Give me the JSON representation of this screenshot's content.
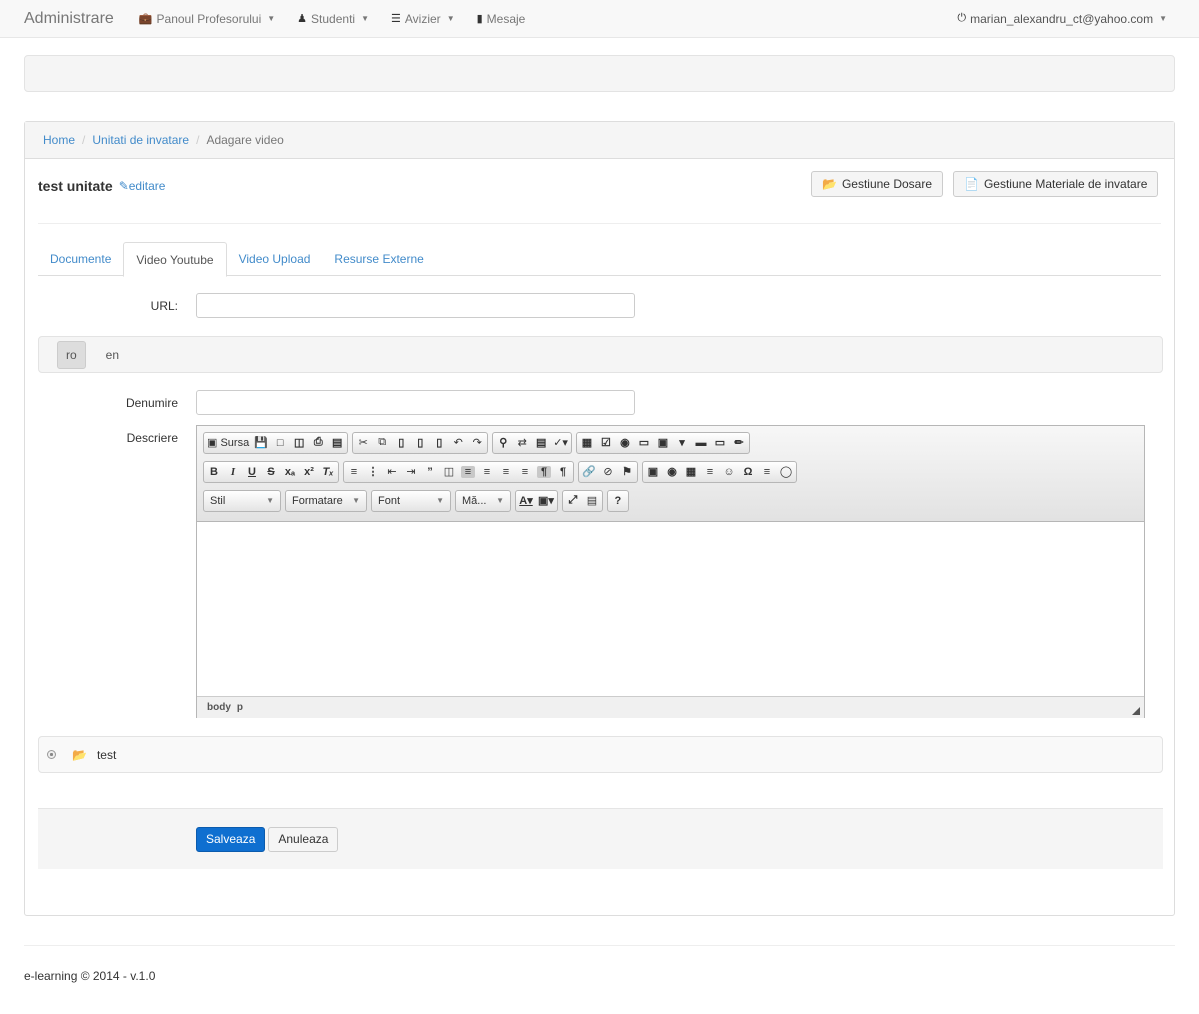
{
  "navbar": {
    "brand": "Administrare",
    "items": [
      {
        "icon": "briefcase-icon",
        "label": "Panoul Profesorului"
      },
      {
        "icon": "user-icon",
        "label": "Studenti"
      },
      {
        "icon": "list-icon",
        "label": "Avizier"
      },
      {
        "icon": "comment-icon",
        "label": "Mesaje"
      }
    ],
    "user": "marian_alexandru_ct@yahoo.com"
  },
  "breadcrumb": {
    "items": [
      "Home",
      "Unitati de invatare"
    ],
    "active": "Adagare video",
    "separator": "/"
  },
  "unit": {
    "title": "test unitate",
    "edit_label": "editare"
  },
  "buttons": {
    "folders": "Gestiune Dosare",
    "materials": "Gestiune Materiale de invatare"
  },
  "tabs": [
    "Documente",
    "Video Youtube",
    "Video Upload",
    "Resurse Externe"
  ],
  "active_tab": "Video Youtube",
  "form": {
    "url_label": "URL:",
    "url_value": "",
    "languages": [
      "ro",
      "en"
    ],
    "active_language": "ro",
    "name_label": "Denumire",
    "name_value": "",
    "description_label": "Descriere"
  },
  "editor": {
    "source_label": "Sursa",
    "combos": [
      "Stil",
      "Formatare",
      "Font",
      "Mă..."
    ],
    "path": [
      "body",
      "p"
    ]
  },
  "folder": {
    "name": "test"
  },
  "actions": {
    "save": "Salveaza",
    "cancel": "Anuleaza"
  },
  "footer": "e-learning © 2014 - v.1.0"
}
